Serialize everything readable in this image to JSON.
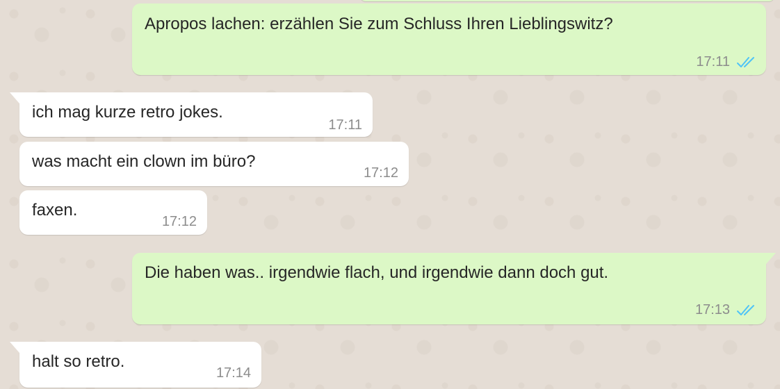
{
  "messages": [
    {
      "direction": "outgoing",
      "text": "Apropos lachen: erzählen Sie zum Schluss Ihren Lieblingswitz?",
      "time": "17:11",
      "status": "read",
      "status_icon": "double-check-icon"
    },
    {
      "direction": "incoming",
      "text": "ich mag kurze retro jokes.",
      "time": "17:11"
    },
    {
      "direction": "incoming",
      "text": "was macht ein clown im büro?",
      "time": "17:12"
    },
    {
      "direction": "incoming",
      "text": "faxen.",
      "time": "17:12"
    },
    {
      "direction": "outgoing",
      "text": "Die haben was.. irgendwie flach, und irgendwie dann doch gut.",
      "time": "17:13",
      "status": "read",
      "status_icon": "double-check-icon"
    },
    {
      "direction": "incoming",
      "text": "halt so retro.",
      "time": "17:14"
    }
  ],
  "colors": {
    "background": "#e5ddd5",
    "outgoing_bubble": "#dcf8c6",
    "incoming_bubble": "#ffffff",
    "text": "#262626",
    "timestamp": "#8c8c8c",
    "read_receipt": "#4fc3f7"
  }
}
